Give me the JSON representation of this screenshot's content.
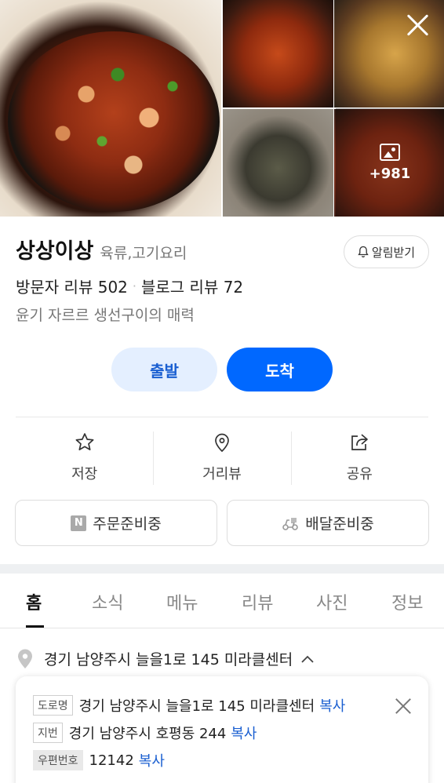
{
  "photos": {
    "more_count": "+981"
  },
  "place": {
    "name": "상상이상",
    "category": "육류,고기요리",
    "alarm_label": "알림받기",
    "visitor_review": "방문자 리뷰 502",
    "blog_review": "블로그 리뷰 72",
    "description": "윤기 자르르 생선구이의 매력"
  },
  "route": {
    "depart_label": "출발",
    "arrive_label": "도착"
  },
  "actions": {
    "save": "저장",
    "street_view": "거리뷰",
    "share": "공유"
  },
  "services": {
    "order": "주문준비중",
    "delivery": "배달준비중"
  },
  "tabs": [
    {
      "label": "홈"
    },
    {
      "label": "소식"
    },
    {
      "label": "메뉴"
    },
    {
      "label": "리뷰"
    },
    {
      "label": "사진"
    },
    {
      "label": "정보"
    }
  ],
  "address": {
    "summary": "경기 남양주시 늘을1로 145 미라클센터",
    "road_tag": "도로명",
    "road": "경기 남양주시 늘을1로 145 미라클센터",
    "lot_tag": "지번",
    "lot": "경기 남양주시 호평동 244",
    "zip_tag": "우편번호",
    "zip": "12142",
    "copy_label": "복사"
  },
  "colors": {
    "primary": "#0068ff",
    "primary_light": "#e4efff",
    "link": "#1a5fd1"
  }
}
